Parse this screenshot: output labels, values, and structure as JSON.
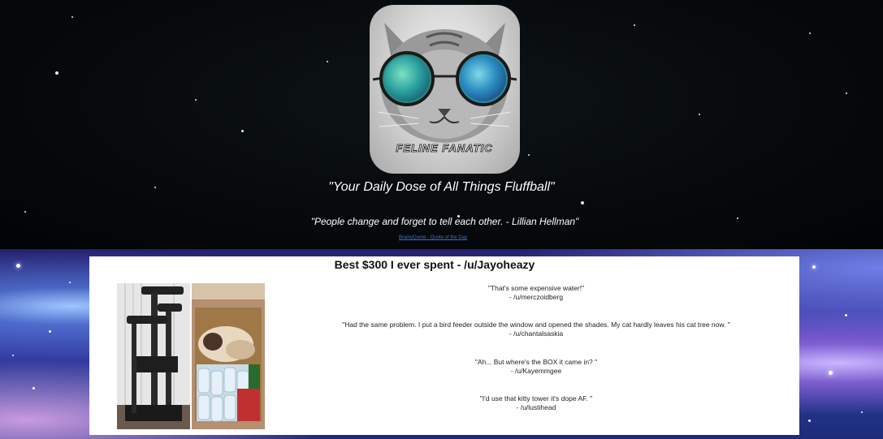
{
  "header": {
    "logo_text": "FELINE FANATIC",
    "tagline": "\"Your Daily Dose of All Things Fluffball\"",
    "quote_of_day": "\"People change and forget to tell each other. - Lillian Hellman\"",
    "quote_credit_link": "BrainyQuote - Quote of the Day"
  },
  "post": {
    "title": "Best $300 I ever spent - /u/Jayoheazy",
    "comments": [
      {
        "text": "\"That's some expensive water!\"",
        "author": "- /u/merczoidberg"
      },
      {
        "text": "\"Had the same problem. I put a bird feeder outside the window and opened the shades. My cat hardly leaves his cat tree now. \"",
        "author": "- /u/chantalsaskia"
      },
      {
        "text": "\"Ah... But where's the BOX it came in? \"",
        "author": "- /u/Kayemmgee"
      },
      {
        "text": "\"I'd use that kitty tower it's dope AF. \"",
        "author": "- /u/lustihead"
      }
    ]
  }
}
